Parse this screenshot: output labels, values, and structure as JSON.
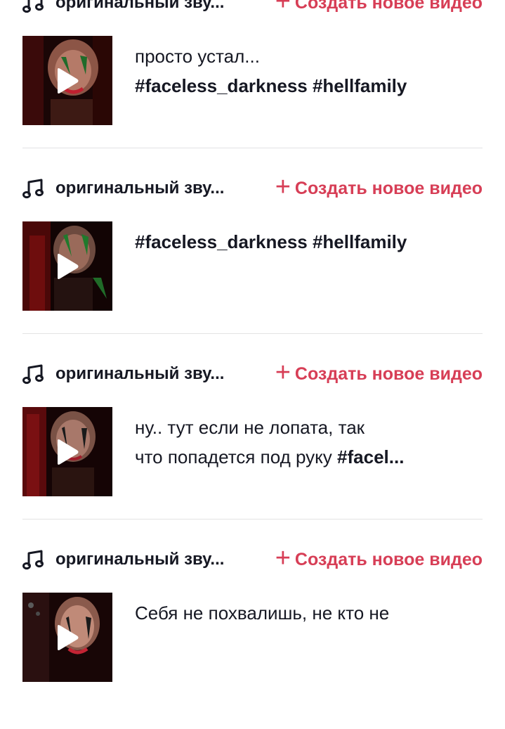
{
  "sound_icon": "music-note-icon",
  "play_icon": "play-icon",
  "accent_color": "#d73e56",
  "posts": [
    {
      "sound_name": "оригинальный зву...",
      "create_label": "Создать новое видео",
      "caption_line1_text": "просто устал...",
      "caption_line1_tag": "",
      "caption_line2_text": "",
      "caption_line2_tag": "#faceless_darkness #hellfamily"
    },
    {
      "sound_name": "оригинальный зву...",
      "create_label": "Создать новое видео",
      "caption_line1_text": "",
      "caption_line1_tag": "#faceless_darkness #hellfamily",
      "caption_line2_text": "",
      "caption_line2_tag": ""
    },
    {
      "sound_name": "оригинальный зву...",
      "create_label": "Создать новое видео",
      "caption_line1_text": "ну.. тут если не лопата, так",
      "caption_line1_tag": "",
      "caption_line2_text": "что попадется под руку ",
      "caption_line2_tag": "#facel..."
    },
    {
      "sound_name": "оригинальный зву...",
      "create_label": "Создать новое видео",
      "caption_line1_text": "Себя не похвалишь, не кто не",
      "caption_line1_tag": "",
      "caption_line2_text": "",
      "caption_line2_tag": ""
    }
  ]
}
